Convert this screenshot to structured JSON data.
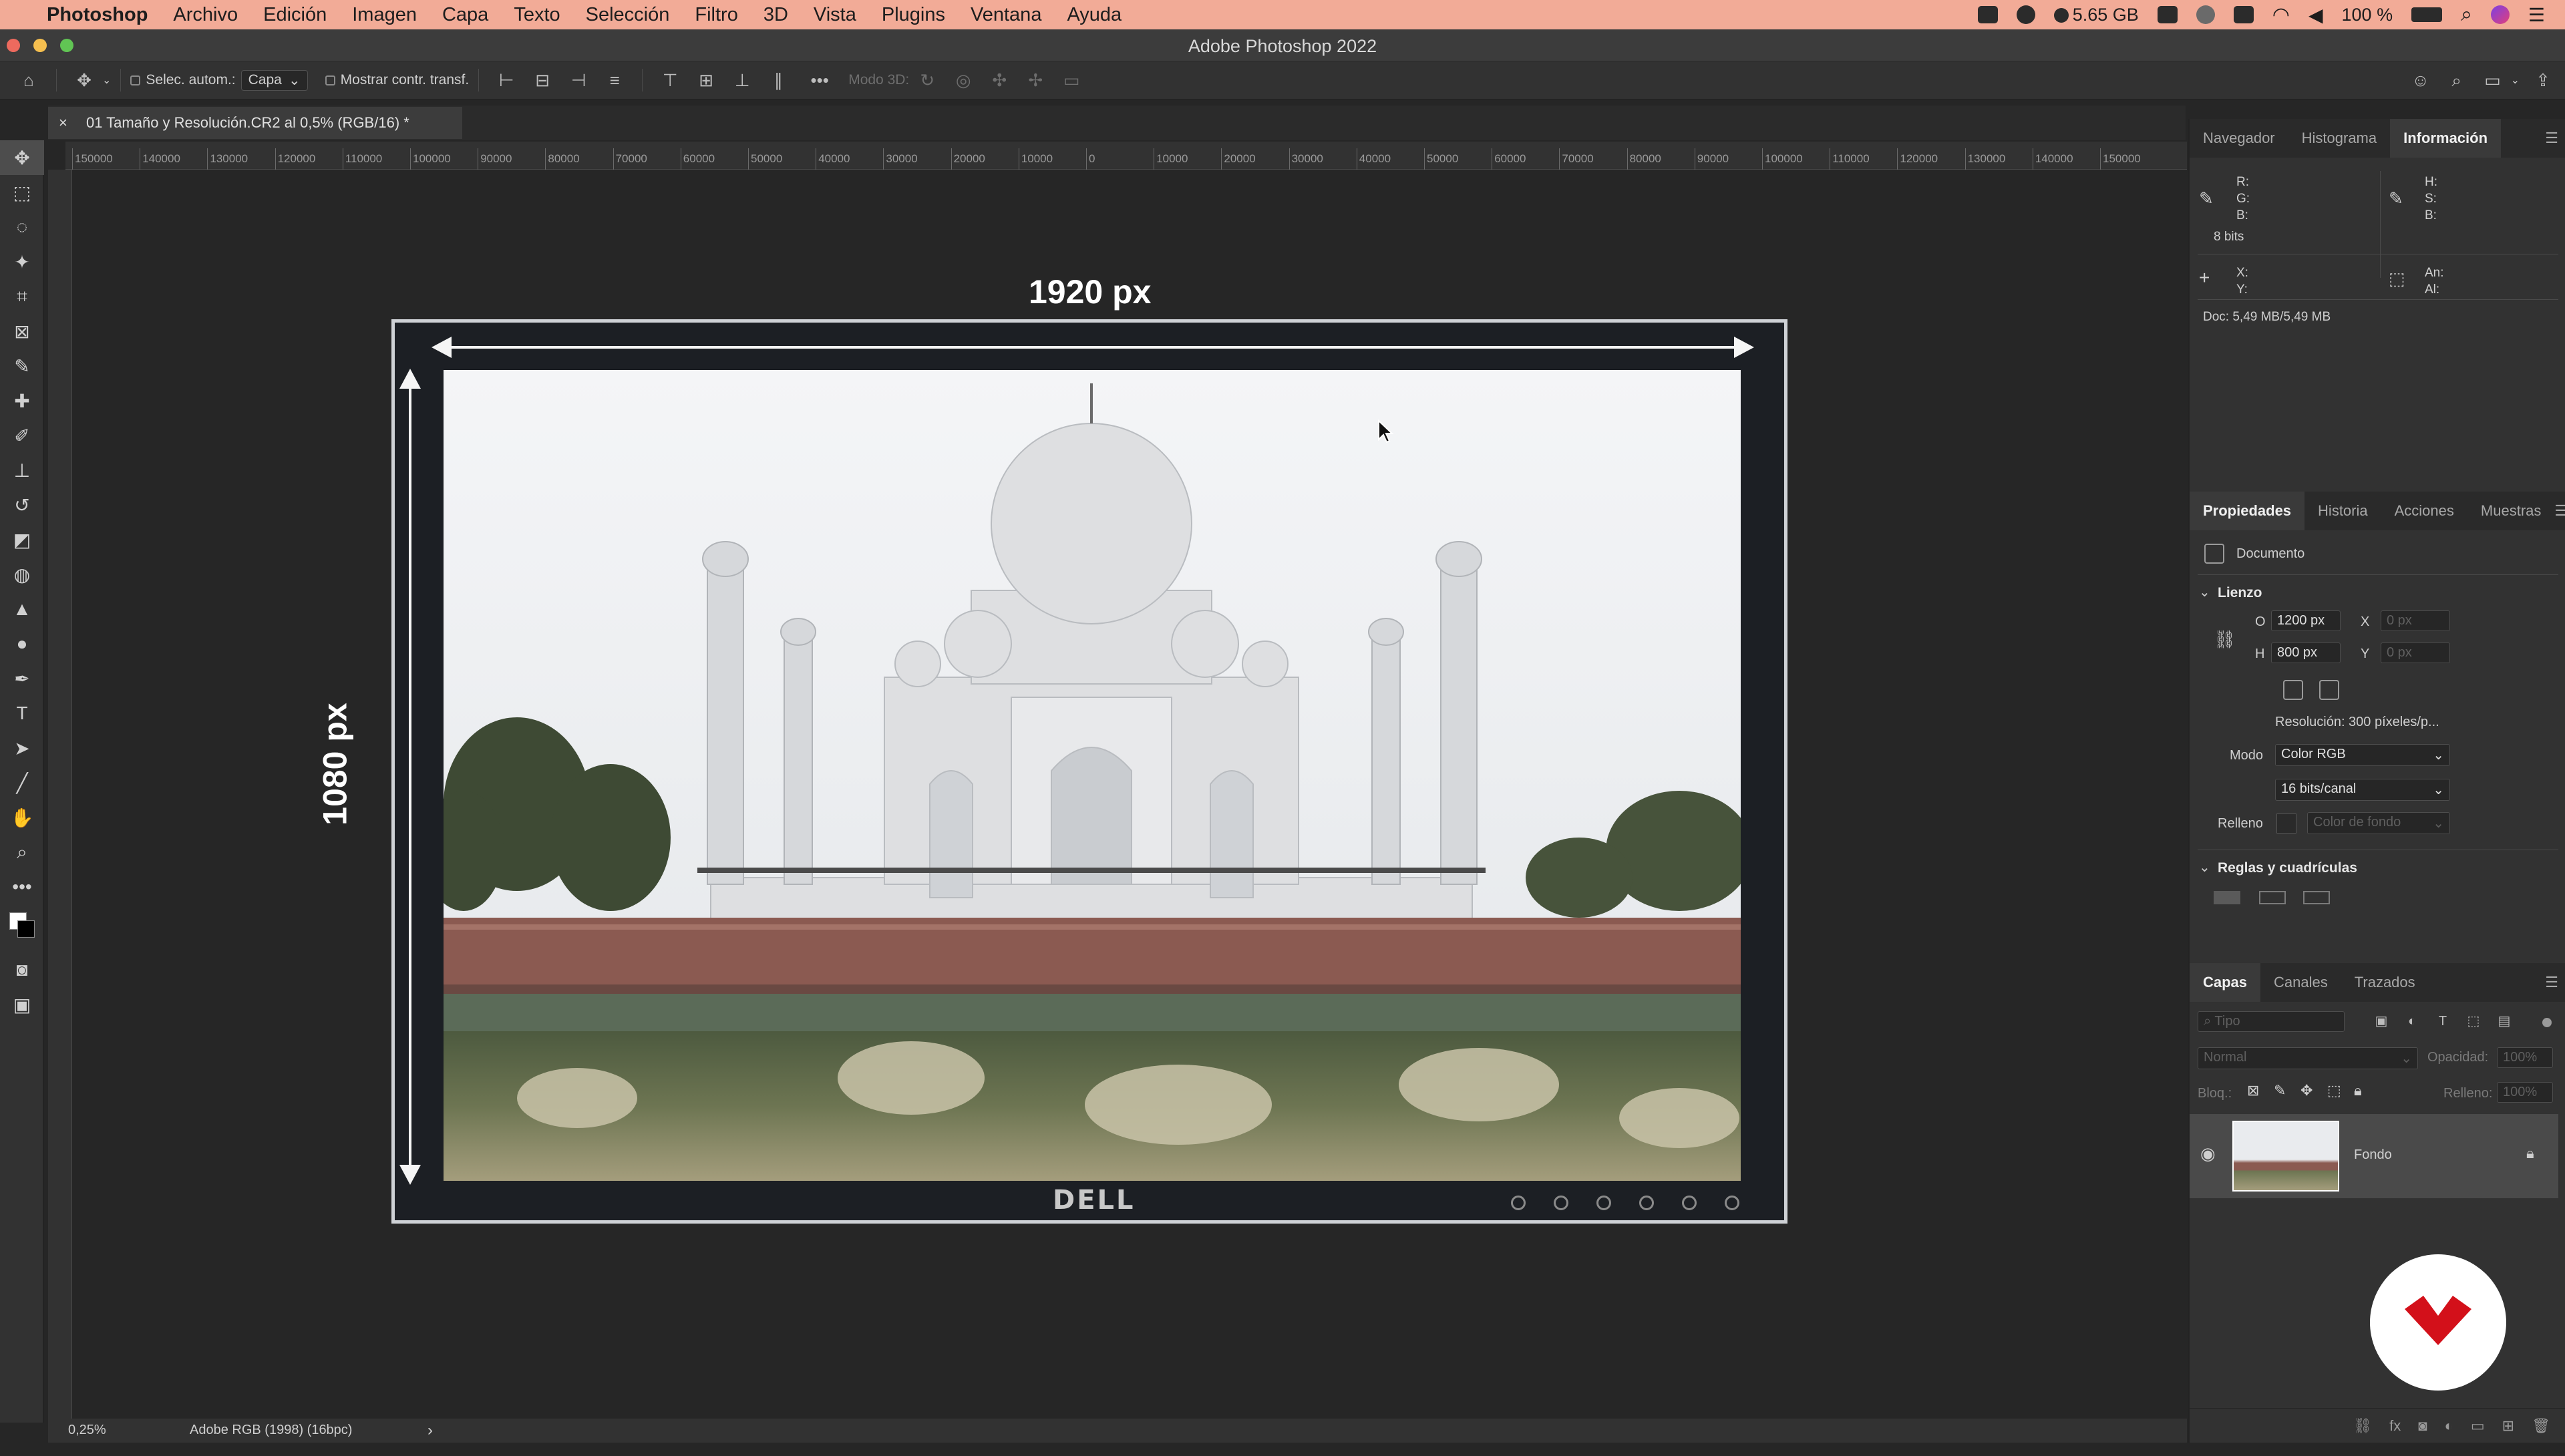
{
  "menubar": {
    "apple_icon": "apple-icon",
    "app_name": "Photoshop",
    "items": [
      "Archivo",
      "Edición",
      "Imagen",
      "Capa",
      "Texto",
      "Selección",
      "Filtro",
      "3D",
      "Vista",
      "Plugins",
      "Ventana",
      "Ayuda"
    ],
    "memory": "5.65 GB",
    "battery": "100 %"
  },
  "window": {
    "title": "Adobe Photoshop 2022"
  },
  "options": {
    "auto_select_label": "Selec. autom.:",
    "auto_select_value": "Capa",
    "show_transform_label": "Mostrar contr. transf.",
    "mode3d_label": "Modo 3D:",
    "more_label": "•••"
  },
  "document": {
    "tab_title": "01 Tamaño y Resolución.CR2 al 0,5% (RGB/16) *",
    "close_glyph": "×"
  },
  "ruler": {
    "ticks": [
      "150000",
      "140000",
      "130000",
      "120000",
      "110000",
      "100000",
      "90000",
      "80000",
      "70000",
      "60000",
      "50000",
      "40000",
      "30000",
      "20000",
      "10000",
      "0",
      "10000",
      "20000",
      "30000",
      "40000",
      "50000",
      "60000",
      "70000",
      "80000",
      "90000",
      "100000",
      "110000",
      "120000",
      "130000",
      "140000",
      "150000"
    ]
  },
  "canvas": {
    "width_label": "1920 px",
    "height_label": "1080 px",
    "brand": "DELL"
  },
  "status": {
    "zoom": "0,25%",
    "profile": "Adobe RGB (1998) (16bpc)",
    "arrow": "›"
  },
  "info_panel": {
    "tabs": [
      "Navegador",
      "Histograma",
      "Información"
    ],
    "rgb": [
      "R:",
      "G:",
      "B:"
    ],
    "hsb": [
      "H:",
      "S:",
      "B:"
    ],
    "bits": "8 bits",
    "xy": [
      "X:",
      "Y:"
    ],
    "size": [
      "An:",
      "Al:"
    ],
    "doc": "Doc: 5,49 MB/5,49 MB"
  },
  "properties_panel": {
    "tabs": [
      "Propiedades",
      "Historia",
      "Acciones",
      "Muestras"
    ],
    "doc_label": "Documento",
    "canvas_section": "Lienzo",
    "w_label": "O",
    "w_value": "1200 px",
    "x_label": "X",
    "x_value": "0 px",
    "h_label": "H",
    "h_value": "800 px",
    "y_label": "Y",
    "y_value": "0 px",
    "resolution": "Resolución: 300 píxeles/p...",
    "mode_label": "Modo",
    "mode_value": "Color RGB",
    "depth_value": "16 bits/canal",
    "fill_label": "Relleno",
    "fill_value": "Color de fondo",
    "rulers_section": "Reglas y cuadrículas"
  },
  "layers_panel": {
    "tabs": [
      "Capas",
      "Canales",
      "Trazados"
    ],
    "search_placeholder": "Tipo",
    "blend_mode": "Normal",
    "opacity_label": "Opacidad:",
    "opacity_value": "100%",
    "lock_label": "Bloq.:",
    "fill_label": "Relleno:",
    "fill_value": "100%",
    "layer_name": "Fondo"
  },
  "colors": {
    "menubar": "#f2ab97",
    "logo_red": "#d3101a",
    "accent_blue": "#2d8ceb"
  }
}
